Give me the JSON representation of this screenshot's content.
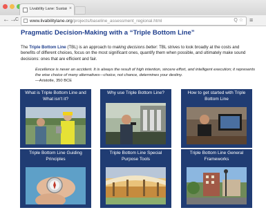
{
  "browser": {
    "tab_title": "Livability Lane: Sustainability ...",
    "tab_close": "×",
    "nav_back": "←",
    "nav_forward": "→",
    "nav_reload": "C",
    "url_domain": "www.livabilitylane.org",
    "url_path": "/projects/baseline_assessment_regional.html",
    "url_tools": "Q ☆",
    "menu": "≡"
  },
  "page": {
    "title": "Pragmatic Decision-Making with a “Triple Bottom Line”",
    "intro_lead": "The ",
    "intro_strong": "Triple Bottom Line",
    "intro_mid": " (TBL) is an approach to ",
    "intro_em": "making decisions better",
    "intro_rest": ": TBL strives to look broadly at the costs and benefits of different choices, focus on the most significant ones, quantify them when possible, and ultimately make sound decisions: ones that are efficient and fair.",
    "quote_text": "Excellence is never an accident. It is always the result of high intention, sincere effort, and intelligent execution; it represents the wise choice of many alternatives—choice, not chance, determines your destiny.",
    "quote_author": "—Aristotle, 350 BCE"
  },
  "tiles": [
    {
      "title": "What is Triple Bottom Line and What isn't it?"
    },
    {
      "title": "Why use Triple Bottom Line?"
    },
    {
      "title": "How to get started with Triple Bottom Line"
    },
    {
      "title": "Triple Bottom Line Guiding Principles"
    },
    {
      "title": "Triple Bottom Line Special Purpose Tools"
    },
    {
      "title": "Triple Bottom Line General Frameworks"
    }
  ],
  "colors": {
    "accent": "#1d3d8c",
    "tile_background": "#203c73",
    "close_dot": "#ee5a52",
    "minimize_dot": "#f4bd4f",
    "zoom_dot": "#62c554"
  }
}
